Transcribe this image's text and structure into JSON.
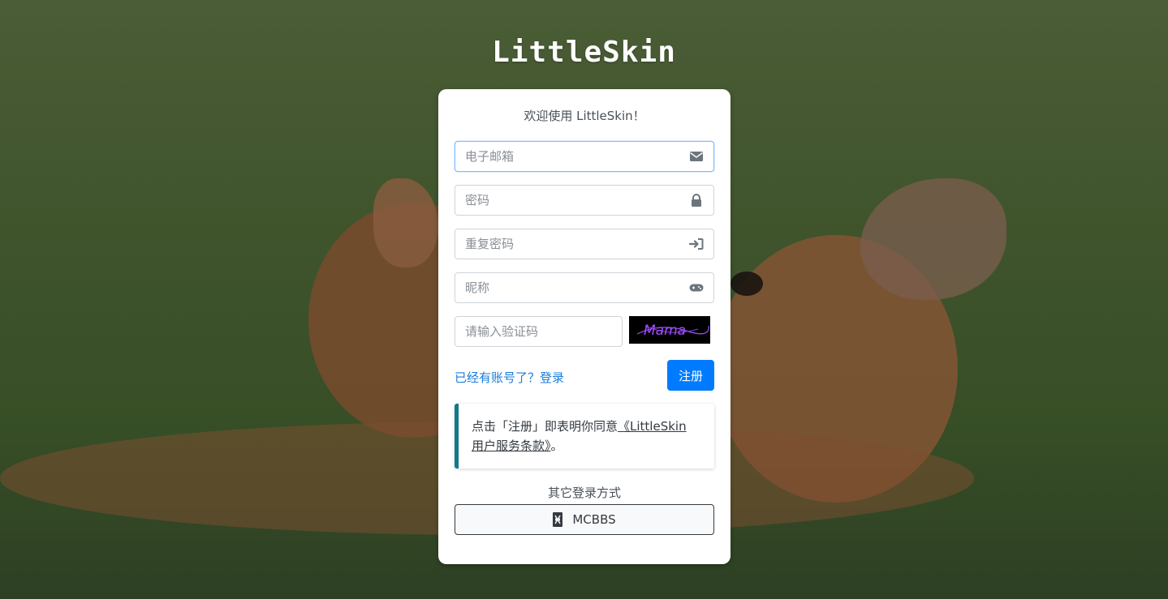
{
  "brand": {
    "logo_text": "LittleSkin"
  },
  "form": {
    "welcome": "欢迎使用 LittleSkin！",
    "email_placeholder": "电子邮箱",
    "password_placeholder": "密码",
    "confirm_password_placeholder": "重复密码",
    "nickname_placeholder": "昵称",
    "captcha_placeholder": "请输入验证码",
    "captcha_text": "Mama",
    "login_link": "已经有账号了？登录",
    "register_button": "注册"
  },
  "agreement": {
    "prefix": "点击「注册」即表明你同意",
    "link": "《LittleSkin 用户服务条款》",
    "suffix": "。"
  },
  "other_login": {
    "title": "其它登录方式",
    "mcbbs_label": "MCBBS"
  },
  "icons": {
    "email": "envelope-icon",
    "password": "lock-icon",
    "confirm_password": "sign-in-icon",
    "nickname": "gamepad-icon",
    "mcbbs": "mcbbs-icon"
  },
  "colors": {
    "primary": "#007bff",
    "link": "#1a7dd8",
    "callout_border": "#117a8b",
    "captcha_text": "#a24dff"
  }
}
